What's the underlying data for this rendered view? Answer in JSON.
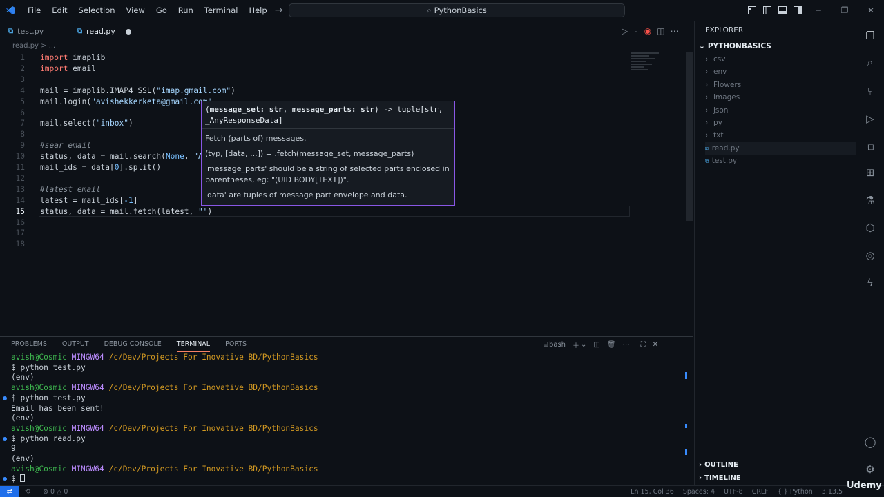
{
  "titlebar": {
    "menus": [
      "File",
      "Edit",
      "Selection",
      "View",
      "Go",
      "Run",
      "Terminal",
      "Help"
    ],
    "search": "PythonBasics"
  },
  "tabs": [
    {
      "label": "test.py",
      "active": false
    },
    {
      "label": "read.py",
      "active": true,
      "modified": true
    }
  ],
  "breadcrumb": "read.py > ...",
  "editor": {
    "lines": [
      {
        "n": "1",
        "html": "<span class=\"kw\">import</span> imaplib"
      },
      {
        "n": "2",
        "html": "<span class=\"kw\">import</span> email"
      },
      {
        "n": "3",
        "html": ""
      },
      {
        "n": "4",
        "html": "mail = imaplib.IMAP4_SSL(<span class=\"str\">\"imap.gmail.com\"</span>)"
      },
      {
        "n": "5",
        "html": "mail.login(<span class=\"str\">\"avishekkerketa@gmail.com\"</span>"
      },
      {
        "n": "6",
        "html": ""
      },
      {
        "n": "7",
        "html": "mail.select(<span class=\"str\">\"inbox\"</span>)"
      },
      {
        "n": "8",
        "html": ""
      },
      {
        "n": "9",
        "html": "<span class=\"cm\">#sear email</span>"
      },
      {
        "n": "10",
        "html": "status, data = mail.search(<span class=\"const\">None</span>, <span class=\"str\">\"A</span>"
      },
      {
        "n": "11",
        "html": "mail_ids = data[<span class=\"num\">0</span>].split()"
      },
      {
        "n": "12",
        "html": ""
      },
      {
        "n": "13",
        "html": "<span class=\"cm\">#latest email</span>"
      },
      {
        "n": "14",
        "html": "latest = mail_ids[<span class=\"num\">-1</span>]"
      },
      {
        "n": "15",
        "html": "status, data = mail.fetch(latest, <span class=\"str\">\"\"</span>)"
      },
      {
        "n": "16",
        "html": ""
      },
      {
        "n": "17",
        "html": ""
      },
      {
        "n": "18",
        "html": ""
      }
    ],
    "current_line": "15"
  },
  "hover": {
    "signature_html": "(<b>message_set: str</b>, <b>message_parts: str</b>) -&gt; tuple[str, _AnyResponseData]",
    "desc1": "Fetch (parts of) messages.",
    "desc2": "(typ, [data, ...]) = .fetch(message_set, message_parts)",
    "desc3": "'message_parts' should be a string of selected parts enclosed in parentheses, eg: \"(UID BODY[TEXT])\".",
    "desc4": "'data' are tuples of message part envelope and data."
  },
  "panel": {
    "tabs": [
      "PROBLEMS",
      "OUTPUT",
      "DEBUG CONSOLE",
      "TERMINAL",
      "PORTS"
    ],
    "active_tab": "TERMINAL",
    "shell": "bash",
    "terminal": [
      {
        "type": "prompt",
        "user": "avish@Cosmic",
        "host": "MINGW64",
        "path": "/c/Dev/Projects For Inovative BD/PythonBasics"
      },
      {
        "type": "text",
        "text": "$ python test.py"
      },
      {
        "type": "text",
        "text": "(env)"
      },
      {
        "type": "prompt",
        "user": "avish@Cosmic",
        "host": "MINGW64",
        "path": "/c/Dev/Projects For Inovative BD/PythonBasics"
      },
      {
        "type": "text",
        "text": "$ python test.py",
        "bullet": true
      },
      {
        "type": "text",
        "text": "Email has been sent!"
      },
      {
        "type": "text",
        "text": "(env)"
      },
      {
        "type": "prompt",
        "user": "avish@Cosmic",
        "host": "MINGW64",
        "path": "/c/Dev/Projects For Inovative BD/PythonBasics"
      },
      {
        "type": "text",
        "text": "$ python read.py",
        "bullet": true
      },
      {
        "type": "text",
        "text": "9"
      },
      {
        "type": "text",
        "text": "(env)"
      },
      {
        "type": "prompt",
        "user": "avish@Cosmic",
        "host": "MINGW64",
        "path": "/c/Dev/Projects For Inovative BD/PythonBasics"
      },
      {
        "type": "text",
        "text": "$ ",
        "bullet": true,
        "cursor": true
      }
    ]
  },
  "explorer": {
    "header": "EXPLORER",
    "root": "PYTHONBASICS",
    "items": [
      {
        "label": "csv",
        "kind": "folder"
      },
      {
        "label": "env",
        "kind": "folder"
      },
      {
        "label": "Flowers",
        "kind": "folder"
      },
      {
        "label": "images",
        "kind": "folder"
      },
      {
        "label": "json",
        "kind": "folder"
      },
      {
        "label": "py",
        "kind": "folder"
      },
      {
        "label": "txt",
        "kind": "folder"
      },
      {
        "label": "read.py",
        "kind": "file",
        "selected": true
      },
      {
        "label": "test.py",
        "kind": "file"
      }
    ],
    "outline": "OUTLINE",
    "timeline": "TIMELINE"
  },
  "statusbar": {
    "errors": "0",
    "warnings": "0",
    "position": "Ln 15, Col 36",
    "spaces": "Spaces: 4",
    "encoding": "UTF-8",
    "eol": "CRLF",
    "language": "Python",
    "version": "3.13.5"
  },
  "watermark": {
    "udemy": "Udemy"
  },
  "colors": {
    "accent": "#1f6feb",
    "hover_border": "#8957e5",
    "bg": "#0d1117"
  }
}
